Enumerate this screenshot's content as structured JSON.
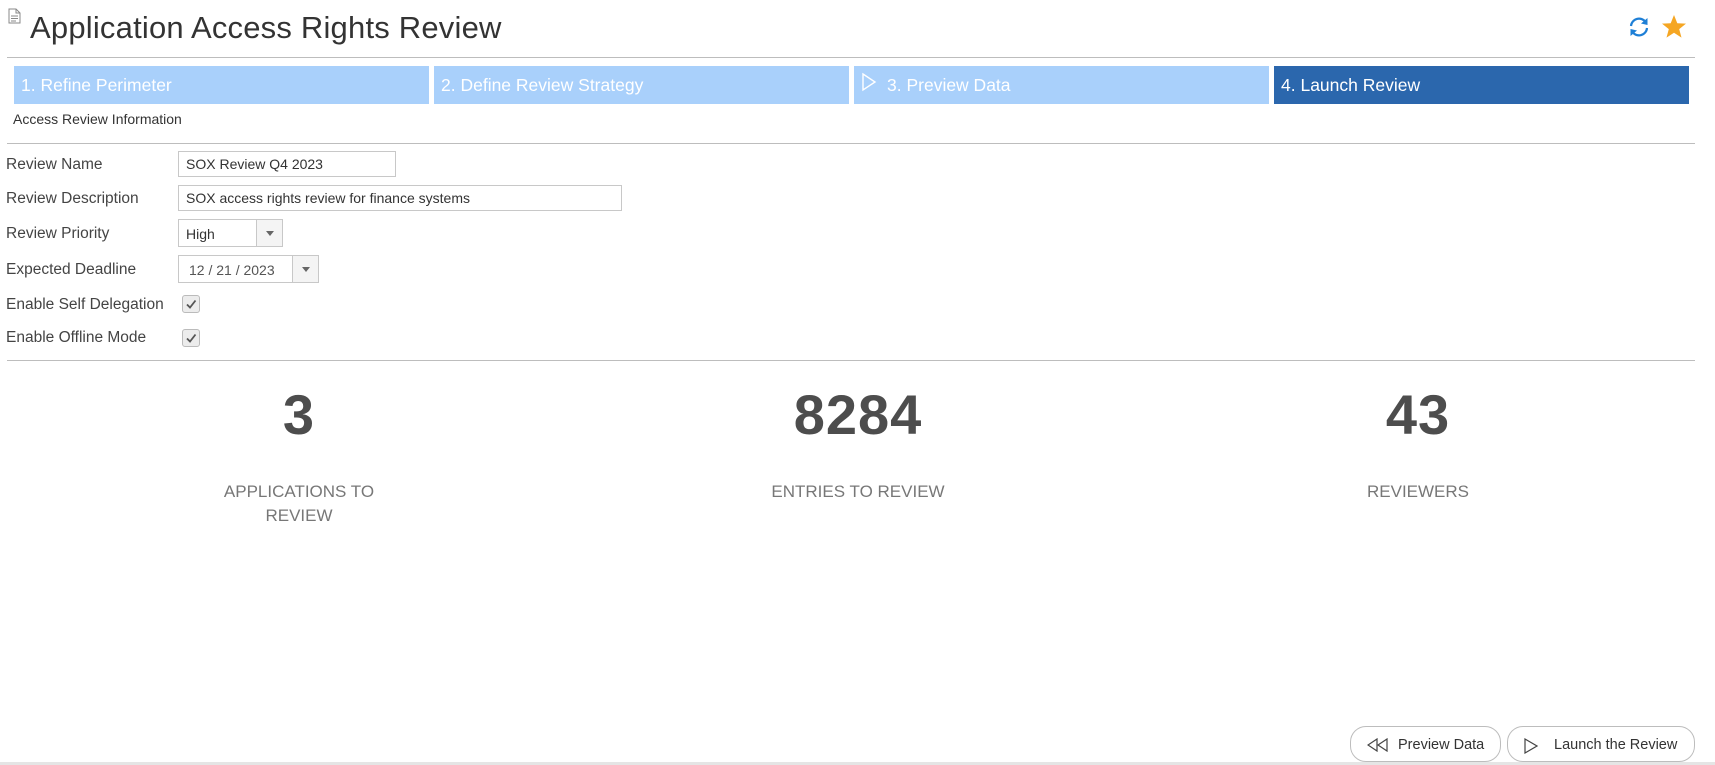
{
  "header": {
    "title": "Application Access Rights Review",
    "icons": {
      "document": "document-icon",
      "refresh": "refresh-icon",
      "favorite": "star-icon"
    },
    "colors": {
      "refresh": "#1e7fd6",
      "star": "#f5a623"
    }
  },
  "wizard": {
    "steps": [
      {
        "label": "1. Refine Perimeter",
        "active": false
      },
      {
        "label": "2. Define Review Strategy",
        "active": false
      },
      {
        "label": "3. Preview Data",
        "active": false,
        "icon": "play-icon"
      },
      {
        "label": "4. Launch Review",
        "active": true
      }
    ],
    "colors": {
      "inactive": "#a9d0fb",
      "active": "#2b67ad"
    }
  },
  "section": {
    "label": "Access Review Information"
  },
  "form": {
    "review_name": {
      "label": "Review Name",
      "value": "SOX Review Q4 2023"
    },
    "review_description": {
      "label": "Review Description",
      "value": "SOX access rights review for finance systems"
    },
    "review_priority": {
      "label": "Review Priority",
      "value": "High"
    },
    "expected_deadline": {
      "label": "Expected Deadline",
      "value": "12 / 21 / 2023"
    },
    "enable_self_delegation": {
      "label": "Enable Self Delegation",
      "checked": true
    },
    "enable_offline_mode": {
      "label": "Enable Offline Mode",
      "checked": true
    }
  },
  "stats": {
    "applications": {
      "value": "3",
      "label_line1": "APPLICATIONS TO",
      "label_line2": "REVIEW"
    },
    "entries": {
      "value": "8284",
      "label": "ENTRIES TO REVIEW"
    },
    "reviewers": {
      "value": "43",
      "label": "REVIEWERS"
    }
  },
  "footer": {
    "preview_button": "Preview Data",
    "launch_button": "Launch the Review"
  }
}
